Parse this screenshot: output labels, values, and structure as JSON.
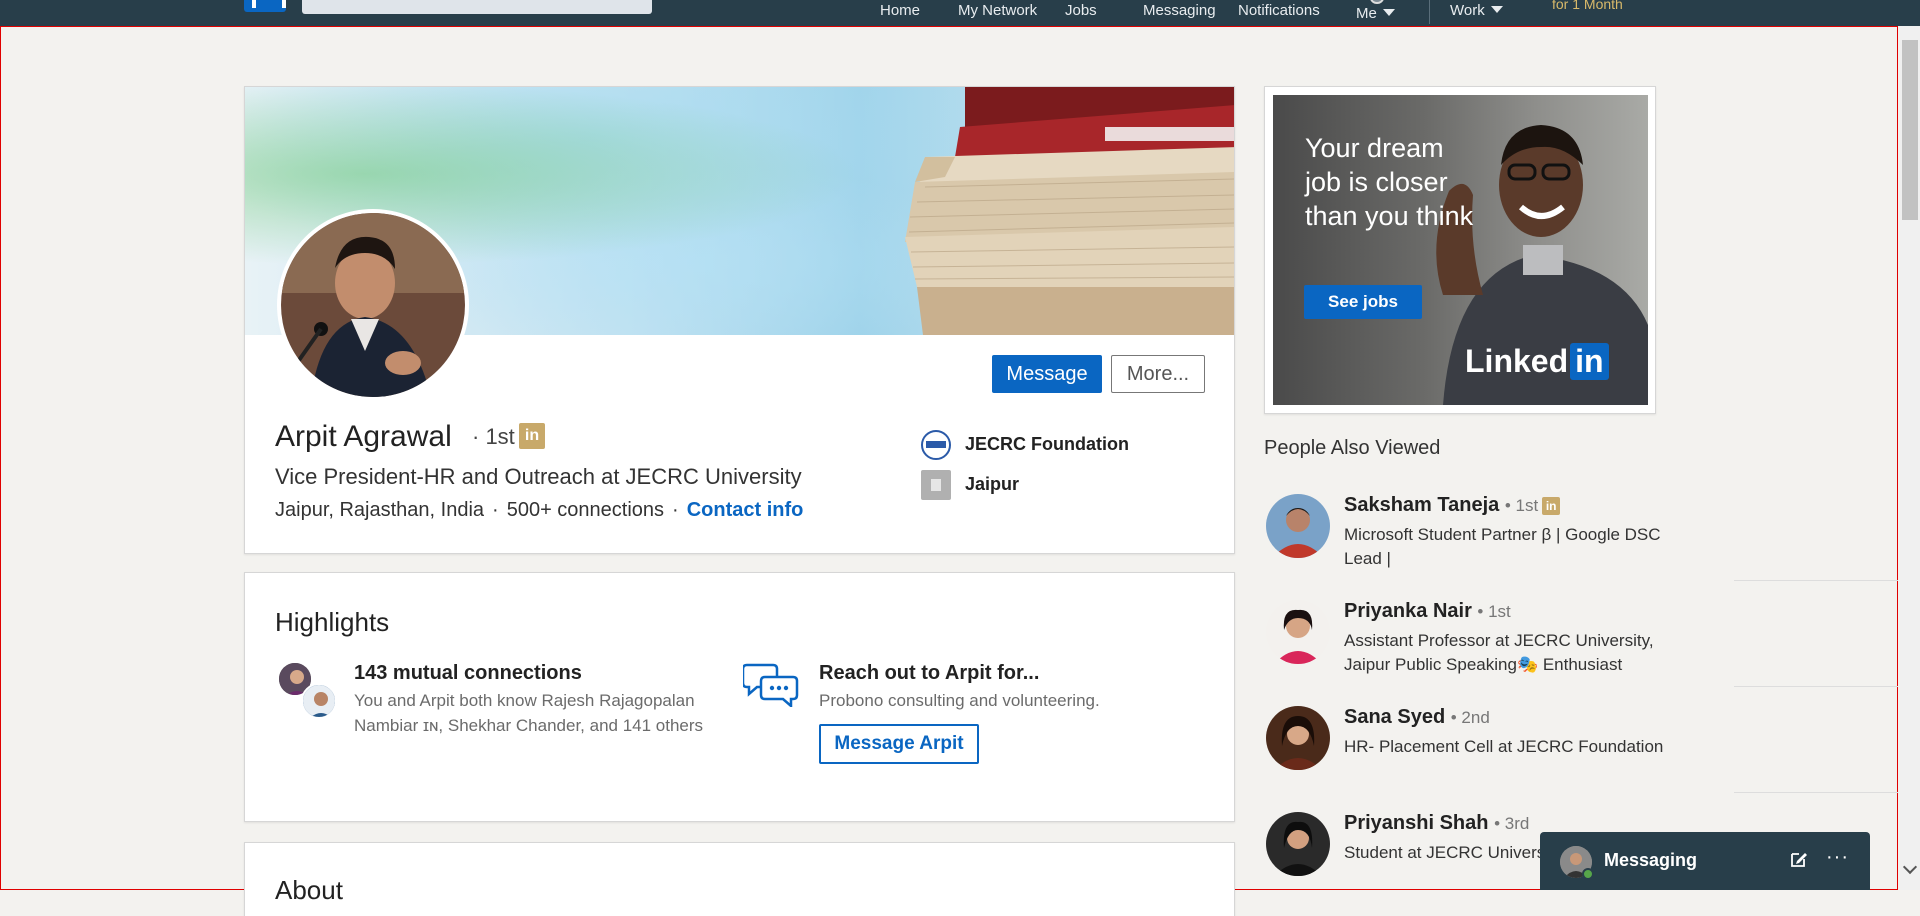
{
  "nav": {
    "items": [
      {
        "label": "Home"
      },
      {
        "label": "My Network"
      },
      {
        "label": "Jobs"
      },
      {
        "label": "Messaging"
      },
      {
        "label": "Notifications"
      },
      {
        "label": "Me"
      },
      {
        "label": "Work"
      }
    ],
    "premium": "for 1 Month"
  },
  "profile": {
    "name": "Arpit Agrawal",
    "degree": "· 1st",
    "badge": "in",
    "headline": "Vice President-HR and Outreach at JECRC University",
    "location": "Jaipur, Rajasthan, India",
    "connections": "500+ connections",
    "contact_info": "Contact info",
    "separator": "·",
    "message_button": "Message",
    "more_button": "More...",
    "organization": "JECRC Foundation",
    "city": "Jaipur"
  },
  "highlights": {
    "title": "Highlights",
    "mutual": {
      "heading": "143 mutual connections",
      "text": "You and Arpit both know Rajesh Rajagopalan Nambiar ɪɴ, Shekhar Chander, and 141 others"
    },
    "reach": {
      "heading": "Reach out to Arpit for...",
      "text": "Probono consulting and volunteering.",
      "button": "Message Arpit"
    }
  },
  "about": {
    "title": "About"
  },
  "ad": {
    "text": "Your dream job is closer than you think",
    "button": "See jobs",
    "logo_text": "Linked",
    "logo_in": "in"
  },
  "people_also_viewed": {
    "title": "People Also Viewed",
    "items": [
      {
        "name": "Saksham Taneja",
        "degree": "• 1st",
        "badge": "in",
        "headline": "Microsoft Student Partner β | Google DSC Lead |"
      },
      {
        "name": "Priyanka Nair",
        "degree": "• 1st",
        "headline": "Assistant Professor at JECRC University, Jaipur Public Speaking🎭 Enthusiast"
      },
      {
        "name": "Sana Syed",
        "degree": "• 2nd",
        "headline": "HR- Placement Cell at JECRC Foundation"
      },
      {
        "name": "Priyanshi Shah",
        "degree": "• 3rd",
        "headline": "Student at JECRC Univers"
      }
    ]
  },
  "messaging": {
    "label": "Messaging",
    "more": "···"
  },
  "colors": {
    "nav_bg": "#283e4a",
    "brand_blue": "#0a66c2",
    "premium_gold": "#c8a96a",
    "frame_border": "#e00000"
  },
  "icons": [
    "linkedin-logo-icon",
    "caret-down-icon",
    "linkedin-badge-icon",
    "jecrc-logo-icon",
    "building-icon",
    "chat-bubbles-icon",
    "compose-icon",
    "more-icon",
    "scroll-down-icon"
  ]
}
